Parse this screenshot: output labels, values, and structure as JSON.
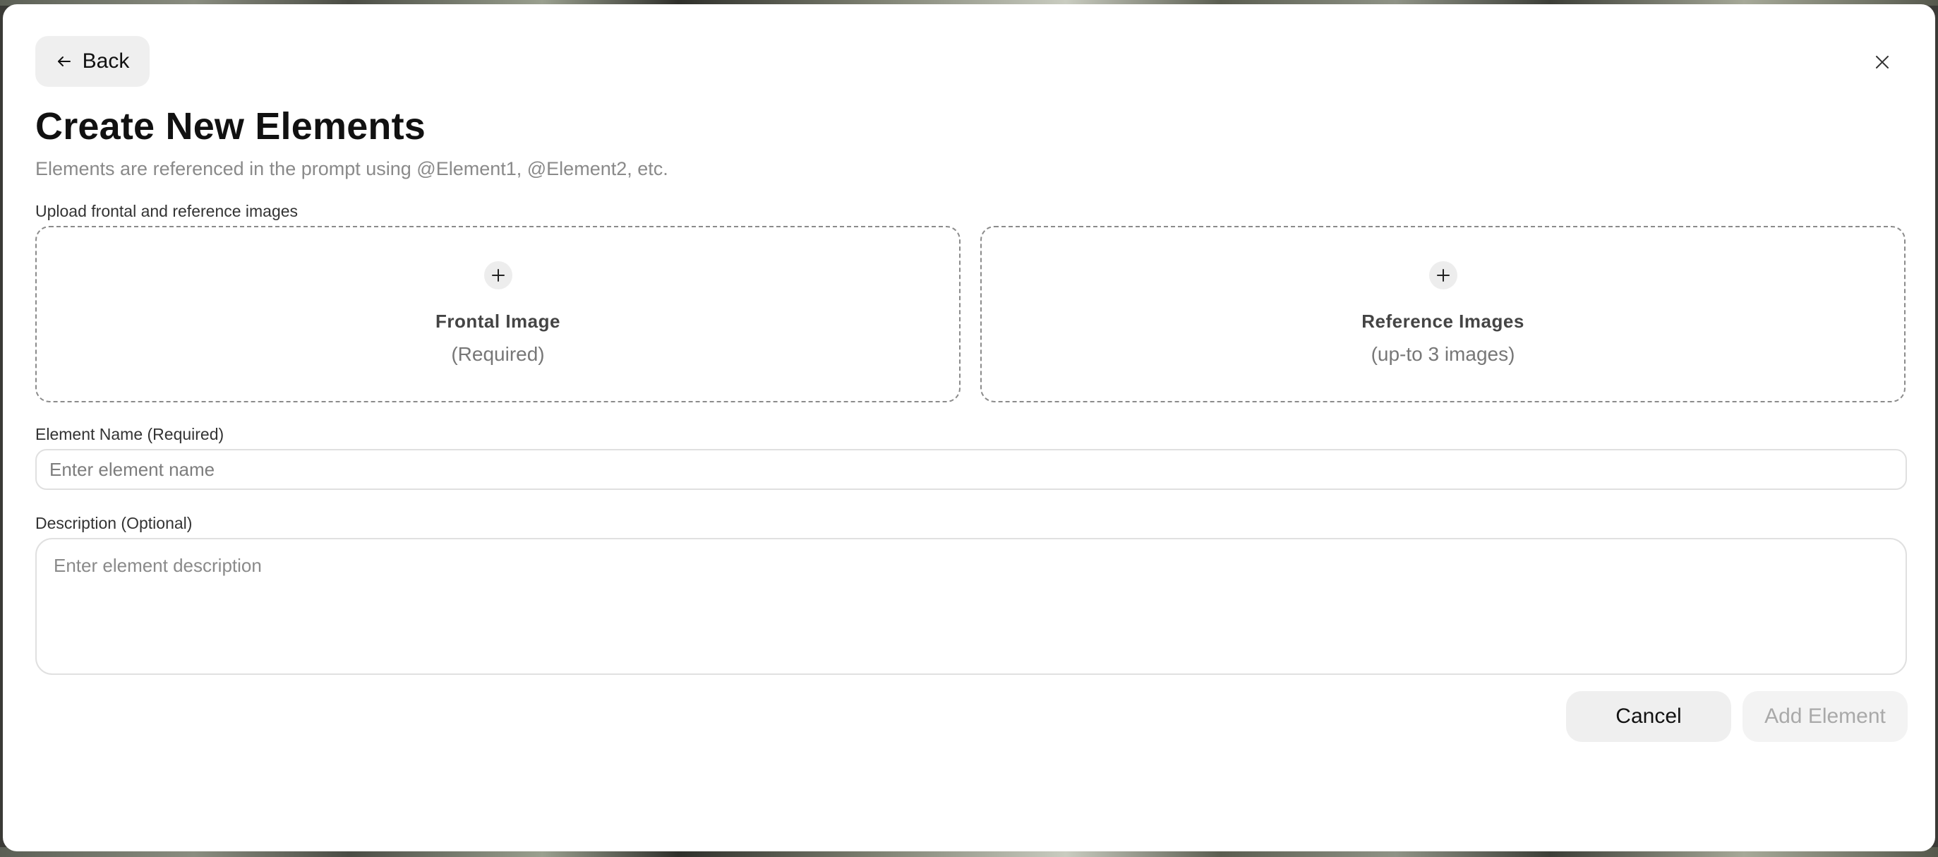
{
  "dialog": {
    "back_label": "Back",
    "title": "Create New Elements",
    "subtitle": "Elements are referenced in the prompt using @Element1, @Element2, etc.",
    "upload_label": "Upload frontal and reference images",
    "frontal": {
      "title": "Frontal Image",
      "subtitle": "(Required)"
    },
    "reference": {
      "title": "Reference Images",
      "subtitle": "(up-to 3 images)"
    },
    "name_field": {
      "label": "Element Name (Required)",
      "value": "",
      "placeholder": "Enter element name"
    },
    "description_field": {
      "label": "Description (Optional)",
      "value": "",
      "placeholder": "Enter element description"
    },
    "cancel_label": "Cancel",
    "add_label": "Add Element",
    "add_enabled": false
  },
  "icons": {
    "back": "arrow-left-icon",
    "close": "close-icon",
    "add": "plus-icon"
  }
}
